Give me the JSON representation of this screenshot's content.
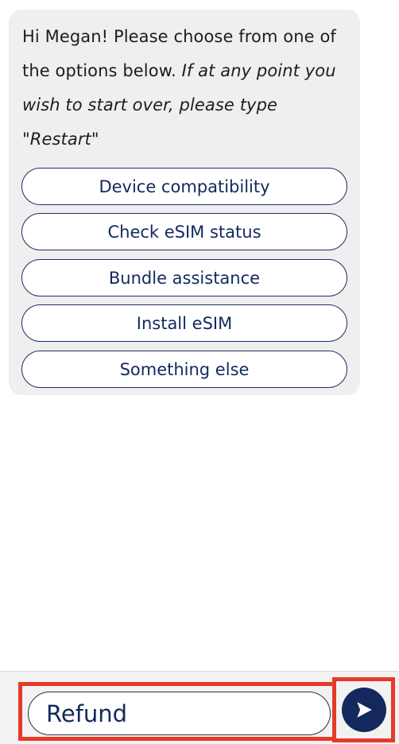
{
  "chat": {
    "greeting": "Hi Megan! Please choose from one of the options below.",
    "instruction_prefix": "If at any point you wish to start over, please type \"",
    "restart_keyword": "Restart",
    "instruction_suffix": "\"",
    "options": [
      {
        "label": "Device compatibility"
      },
      {
        "label": "Check eSIM status"
      },
      {
        "label": "Bundle assistance"
      },
      {
        "label": "Install eSIM"
      },
      {
        "label": "Something else"
      }
    ]
  },
  "composer": {
    "input_value": "Refund",
    "send_icon": "send-arrow-icon"
  },
  "colors": {
    "brand_navy": "#13295e",
    "bubble_bg": "#efefef",
    "highlight": "#e53a2a"
  }
}
